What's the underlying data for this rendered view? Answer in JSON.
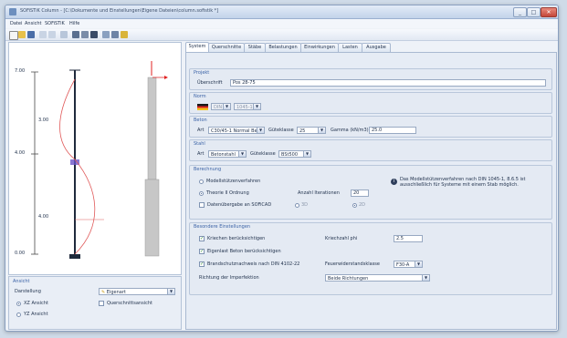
{
  "window": {
    "title": "SOFiSTiK Column - [C:\\Dokumente und Einstellungen\\Eigene Dateien\\column.sofistik *]"
  },
  "title_controls": {
    "minimize": "_",
    "maximize": "□",
    "close": "✕"
  },
  "menu": [
    "Datei",
    "Ansicht",
    "SOFiSTiK",
    "Hilfe"
  ],
  "tabs": [
    "System",
    "Querschnitte",
    "Stäbe",
    "Belastungen",
    "Einwirkungen",
    "Lasten",
    "Ausgabe"
  ],
  "active_tab": "System",
  "diagram": {
    "level_labels": [
      "7.00",
      "4.00",
      "0.00"
    ],
    "segment_labels": [
      "3.00",
      "4.00"
    ]
  },
  "view": {
    "header": "Ansicht",
    "darstellung_label": "Darstellung",
    "darstellung_value": "Eigenart",
    "radios": [
      "XZ Ansicht",
      "YZ Ansicht"
    ],
    "checkbox": "Querschnittsansicht"
  },
  "projekt": {
    "header": "Projekt",
    "label": "Überschrift",
    "value": "Pos 28-75"
  },
  "norm": {
    "header": "Norm",
    "value": "DIN",
    "year": "1045-1"
  },
  "beton": {
    "header": "Beton",
    "art_label": "Art",
    "art_value": "C30/45-1 Normal Beton",
    "gueteklasse_label": "Güteklasse",
    "gueteklasse_value": "25",
    "gamma_label": "Gamma (kN/m3)",
    "gamma_value": "25.0"
  },
  "stahl": {
    "header": "Stahl",
    "art_label": "Art",
    "art_value": "Betonstahl",
    "gueteklasse_label": "Güteklasse",
    "gueteklasse_value": "BSt500"
  },
  "berechnung": {
    "header": "Berechnung",
    "options": [
      "Modellstützenverfahren",
      "Theorie II Ordnung"
    ],
    "iter_label": "Anzahl Iterationen",
    "iter_value": "20",
    "data_check": "Datenübergabe an SOFiCAD",
    "small_opts": [
      "3D",
      "2D"
    ],
    "info_text": "Das Modellstützenverfahren nach DIN 1045-1, 8.6.5 ist ausschließlich für Systeme mit einem Stab möglich."
  },
  "besondere": {
    "header": "Besondere Einstellungen",
    "kriechen_label": "Kriechen berücksichtigen",
    "kriechzahl_label": "Kriechzahl phi",
    "kriechzahl_value": "2.5",
    "eigengewicht_label": "Eigenlast Beton berücksichtigen",
    "brand_label": "Brandschutznachweis nach DIN 4102-22",
    "feuer_label": "Feuerwiderstandsklasse",
    "feuer_value": "F30-A",
    "richtung_label": "Richtung der Imperfektion",
    "richtung_value": "Beide Richtungen"
  },
  "colors": {
    "accent": "#3a62a6",
    "member": "#1f2a3c",
    "moment": "#e05a5a",
    "support": "#6a55c8"
  }
}
